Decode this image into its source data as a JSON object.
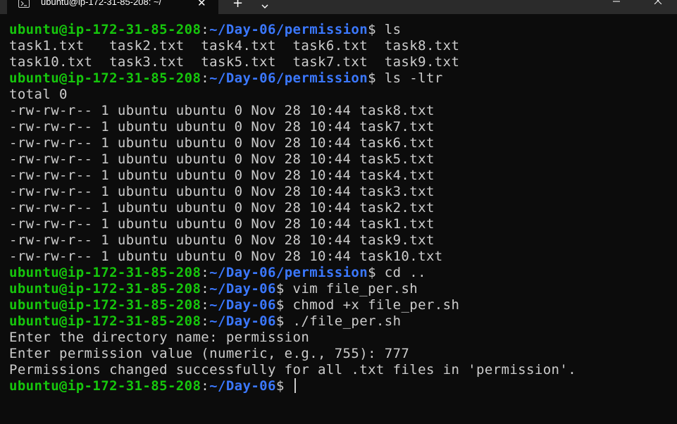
{
  "window": {
    "tab_title": "ubuntu@ip-172-31-85-208: ~/",
    "new_tab_label": "+",
    "close_label": "✕"
  },
  "colors": {
    "background": "#0c0c0c",
    "text": "#cccccc",
    "user_host": "#16c60c",
    "path": "#3b78ff",
    "titlebar": "#2b2b2b"
  },
  "icons": {
    "tab_icon": "terminal-icon",
    "tab_close": "close-icon",
    "new_tab": "plus-icon",
    "dropdown": "chevron-down-icon",
    "minimize": "minimize-icon",
    "close_window": "close-icon"
  },
  "terminal": {
    "lines": [
      {
        "type": "prompt",
        "user": "ubuntu@ip-172-31-85-208",
        "sep": ":",
        "path": "~/Day-06/permission",
        "sym": "$ ",
        "cmd": "ls"
      },
      {
        "type": "output",
        "text": "task1.txt   task2.txt  task4.txt  task6.txt  task8.txt"
      },
      {
        "type": "output",
        "text": "task10.txt  task3.txt  task5.txt  task7.txt  task9.txt"
      },
      {
        "type": "prompt",
        "user": "ubuntu@ip-172-31-85-208",
        "sep": ":",
        "path": "~/Day-06/permission",
        "sym": "$ ",
        "cmd": "ls -ltr"
      },
      {
        "type": "output",
        "text": "total 0"
      },
      {
        "type": "output",
        "text": "-rw-rw-r-- 1 ubuntu ubuntu 0 Nov 28 10:44 task8.txt"
      },
      {
        "type": "output",
        "text": "-rw-rw-r-- 1 ubuntu ubuntu 0 Nov 28 10:44 task7.txt"
      },
      {
        "type": "output",
        "text": "-rw-rw-r-- 1 ubuntu ubuntu 0 Nov 28 10:44 task6.txt"
      },
      {
        "type": "output",
        "text": "-rw-rw-r-- 1 ubuntu ubuntu 0 Nov 28 10:44 task5.txt"
      },
      {
        "type": "output",
        "text": "-rw-rw-r-- 1 ubuntu ubuntu 0 Nov 28 10:44 task4.txt"
      },
      {
        "type": "output",
        "text": "-rw-rw-r-- 1 ubuntu ubuntu 0 Nov 28 10:44 task3.txt"
      },
      {
        "type": "output",
        "text": "-rw-rw-r-- 1 ubuntu ubuntu 0 Nov 28 10:44 task2.txt"
      },
      {
        "type": "output",
        "text": "-rw-rw-r-- 1 ubuntu ubuntu 0 Nov 28 10:44 task1.txt"
      },
      {
        "type": "output",
        "text": "-rw-rw-r-- 1 ubuntu ubuntu 0 Nov 28 10:44 task9.txt"
      },
      {
        "type": "output",
        "text": "-rw-rw-r-- 1 ubuntu ubuntu 0 Nov 28 10:44 task10.txt"
      },
      {
        "type": "prompt",
        "user": "ubuntu@ip-172-31-85-208",
        "sep": ":",
        "path": "~/Day-06/permission",
        "sym": "$ ",
        "cmd": "cd .."
      },
      {
        "type": "prompt",
        "user": "ubuntu@ip-172-31-85-208",
        "sep": ":",
        "path": "~/Day-06",
        "sym": "$ ",
        "cmd": "vim file_per.sh"
      },
      {
        "type": "prompt",
        "user": "ubuntu@ip-172-31-85-208",
        "sep": ":",
        "path": "~/Day-06",
        "sym": "$ ",
        "cmd": "chmod +x file_per.sh"
      },
      {
        "type": "prompt",
        "user": "ubuntu@ip-172-31-85-208",
        "sep": ":",
        "path": "~/Day-06",
        "sym": "$ ",
        "cmd": "./file_per.sh"
      },
      {
        "type": "output",
        "text": "Enter the directory name: permission"
      },
      {
        "type": "output",
        "text": "Enter permission value (numeric, e.g., 755): 777"
      },
      {
        "type": "output",
        "text": "Permissions changed successfully for all .txt files in 'permission'."
      },
      {
        "type": "prompt",
        "user": "ubuntu@ip-172-31-85-208",
        "sep": ":",
        "path": "~/Day-06",
        "sym": "$ ",
        "cmd": "",
        "cursor": true
      }
    ]
  }
}
